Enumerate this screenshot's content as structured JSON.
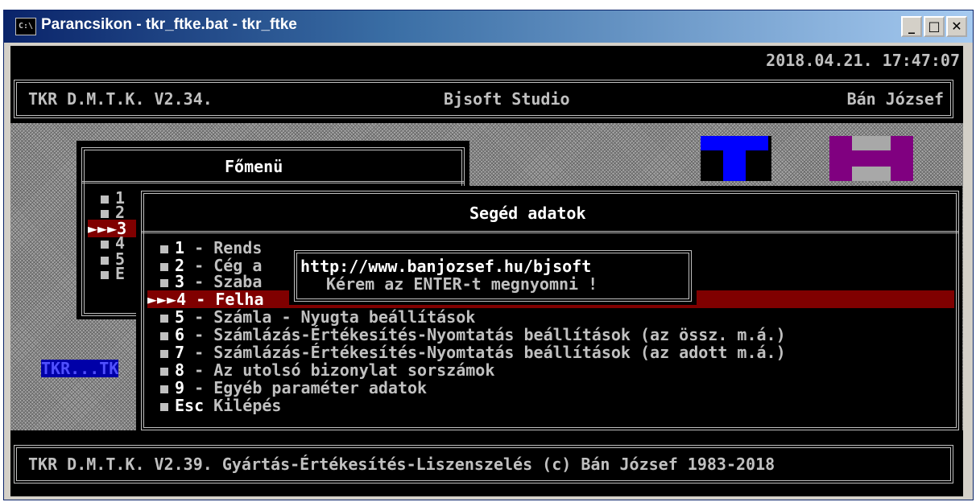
{
  "window": {
    "title": "Parancsikon - tkr_ftke.bat - tkr_ftke",
    "icon": "cmd-icon",
    "min": "_",
    "max": "□",
    "close": "✕"
  },
  "status_bar": {
    "datetime": "2018.04.21. 17:47:07"
  },
  "header": {
    "left": "TKR D.M.T.K. V2.34.",
    "center": "Bjsoft Studio",
    "right": "Bán József"
  },
  "main_menu": {
    "title": "Főmenü",
    "items": [
      "1",
      "2",
      "3",
      "4",
      "5",
      "E"
    ],
    "selected_marker": "►►►"
  },
  "side_label": "TKR...TK",
  "sub_menu": {
    "title": "Segéd adatok",
    "items": [
      {
        "key": "1",
        "sep": "-",
        "label": "Rends"
      },
      {
        "key": "2",
        "sep": "-",
        "label": "Cég a"
      },
      {
        "key": "3",
        "sep": "-",
        "label": "Szaba"
      },
      {
        "key": "4",
        "sep": "-",
        "label": "Felha"
      },
      {
        "key": "5",
        "sep": "-",
        "label": "Számla - Nyugta beállítások"
      },
      {
        "key": "6",
        "sep": "-",
        "label": "Számlázás-Értékesítés-Nyomtatás beállítások (az össz. m.á.)"
      },
      {
        "key": "7",
        "sep": "-",
        "label": "Számlázás-Értékesítés-Nyomtatás beállítások (az adott m.á.)"
      },
      {
        "key": "8",
        "sep": "-",
        "label": "Az utolsó bizonylat sorszámok"
      },
      {
        "key": "9",
        "sep": "-",
        "label": "Egyéb paraméter adatok"
      },
      {
        "key": "Esc",
        "sep": "",
        "label": "Kilépés"
      }
    ],
    "selected_index": 3
  },
  "popup": {
    "url": "http://www.banjozsef.hu/bjsoft",
    "message": "Kérem az ENTER-t megnyomni !"
  },
  "footer": {
    "text": "TKR D.M.T.K. V2.39. Gyártás-Értékesítés-Liszenszelés (c) Bán József 1983-2018"
  },
  "colors": {
    "selection": "#800000",
    "logo_blue": "#0000ff",
    "logo_purple": "#800080",
    "side_label_bg": "#0000a8"
  }
}
